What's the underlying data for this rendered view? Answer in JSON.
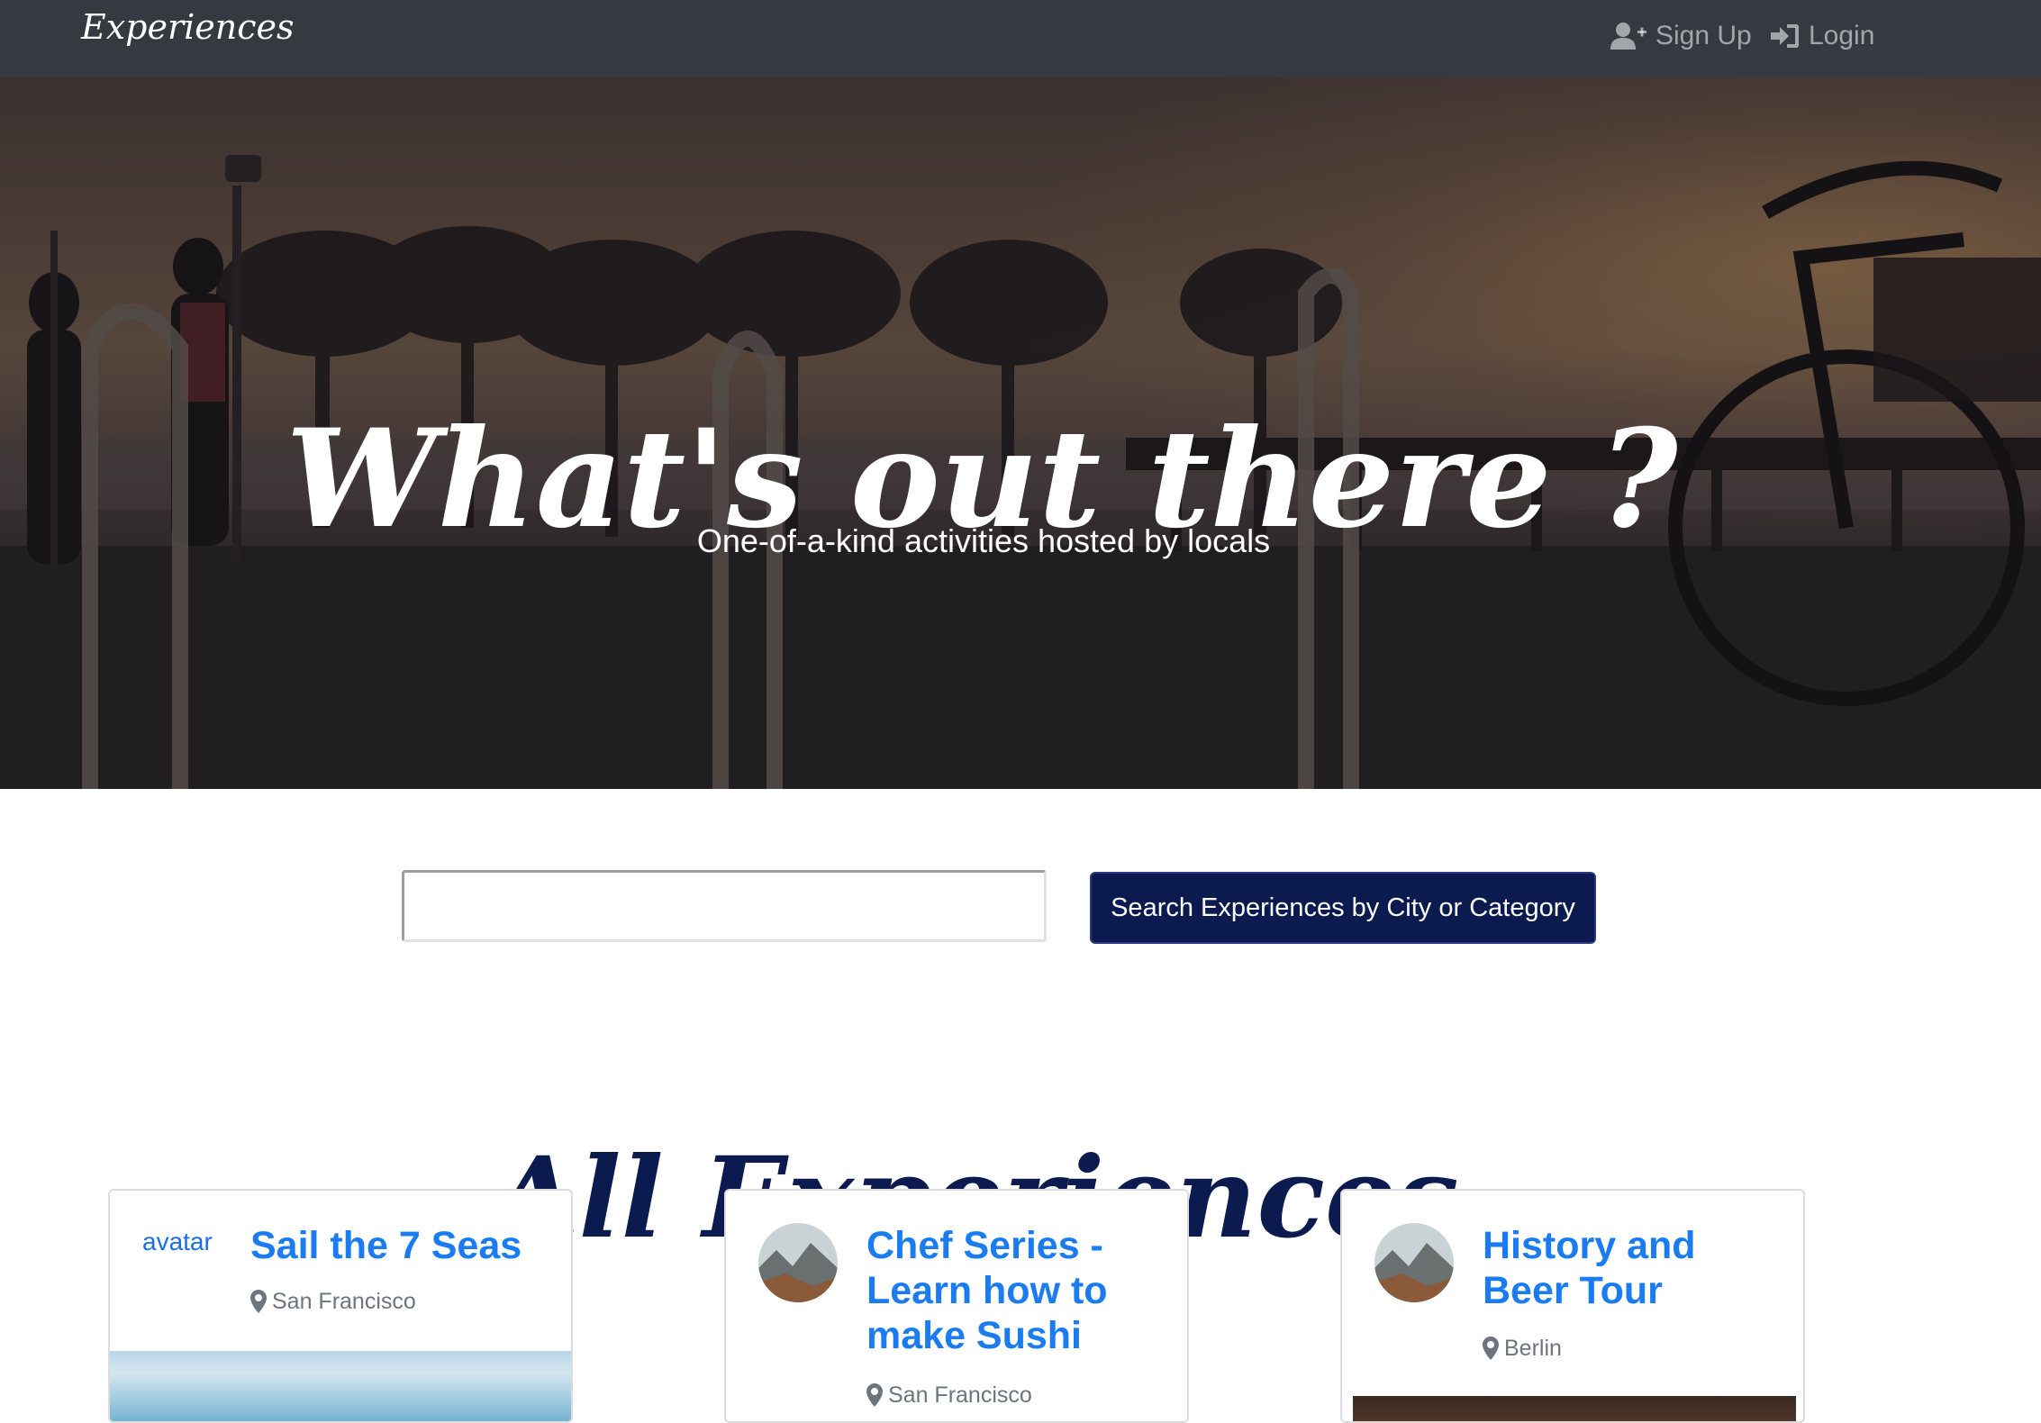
{
  "navbar": {
    "brand": "Experiences",
    "signup_label": "Sign Up",
    "login_label": "Login"
  },
  "hero": {
    "title": "What's out there ?",
    "subtitle": "One-of-a-kind activities hosted by locals"
  },
  "search": {
    "value": "",
    "button_label": "Search Experiences by City or Category"
  },
  "section": {
    "title": "All Experiences"
  },
  "cards": [
    {
      "title": "Sail the 7 Seas",
      "location": "San Francisco",
      "avatar_alt": "avatar"
    },
    {
      "title": "Chef Series - Learn how to make Sushi",
      "location": "San Francisco"
    },
    {
      "title": "History and Beer Tour",
      "location": "Berlin"
    }
  ],
  "colors": {
    "navbar_bg": "#343a40",
    "accent_navy": "#0b1a4f",
    "link_blue": "#1a7cf0",
    "muted_gray": "#6c757d"
  },
  "icons": {
    "signup": "user-plus-icon",
    "login": "sign-in-icon",
    "location": "map-marker-icon"
  }
}
